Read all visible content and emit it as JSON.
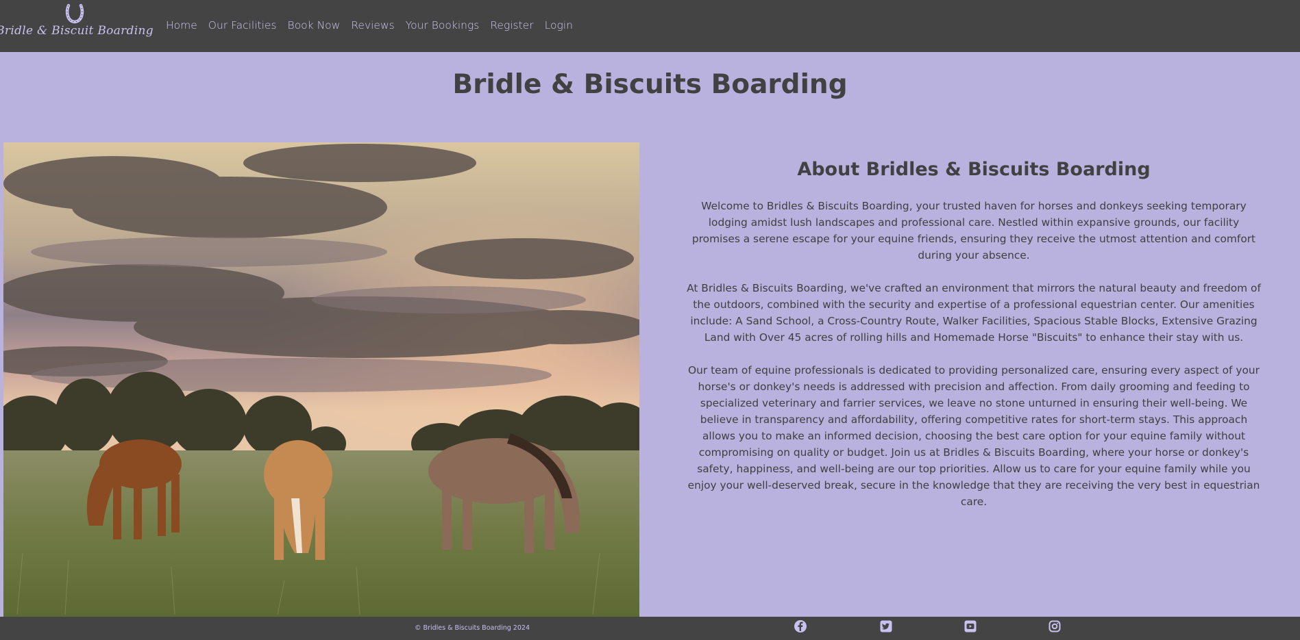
{
  "brand": {
    "logo_text": "Bridle & Biscuit Boarding",
    "logo_icon": "horseshoe-icon"
  },
  "nav": {
    "items": [
      {
        "label": "Home"
      },
      {
        "label": "Our Facilities"
      },
      {
        "label": "Book Now"
      },
      {
        "label": "Reviews"
      },
      {
        "label": "Your Bookings"
      },
      {
        "label": "Register"
      },
      {
        "label": "Login"
      }
    ]
  },
  "main": {
    "title": "Bridle & Biscuits Boarding",
    "about_heading": "About Bridles & Biscuits Boarding",
    "paragraphs": [
      "Welcome to Bridles & Biscuits Boarding, your trusted haven for horses and donkeys seeking temporary lodging amidst lush landscapes and professional care. Nestled within expansive grounds, our facility promises a serene escape for your equine friends, ensuring they receive the utmost attention and comfort during your absence.",
      "At Bridles & Biscuits Boarding, we've crafted an environment that mirrors the natural beauty and freedom of the outdoors, combined with the security and expertise of a professional equestrian center. Our amenities include: A Sand School, a Cross-Country Route, Walker Facilities, Spacious Stable Blocks, Extensive Grazing Land with Over 45 acres of rolling hills and Homemade Horse \"Biscuits\" to enhance their stay with us.",
      "Our team of equine professionals is dedicated to providing personalized care, ensuring every aspect of your horse's or donkey's needs is addressed with precision and affection. From daily grooming and feeding to specialized veterinary and farrier services, we leave no stone unturned in ensuring their well-being. We believe in transparency and affordability, offering competitive rates for short-term stays. This approach allows you to make an informed decision, choosing the best care option for your equine family without compromising on quality or budget. Join us at Bridles & Biscuits Boarding, where your horse or donkey's safety, happiness, and well-being are our top priorities. Allow us to care for your equine family while you enjoy your well-deserved break, secure in the knowledge that they are receiving the very best in equestrian care."
    ]
  },
  "footer": {
    "copyright": "© Bridles & Biscuits Boarding 2024",
    "social": [
      "facebook-icon",
      "twitter-icon",
      "youtube-icon",
      "instagram-icon"
    ]
  },
  "colors": {
    "nav_bg": "#444444",
    "page_bg": "#b9b1de",
    "link": "#cfc8f2",
    "heading": "#414141"
  }
}
